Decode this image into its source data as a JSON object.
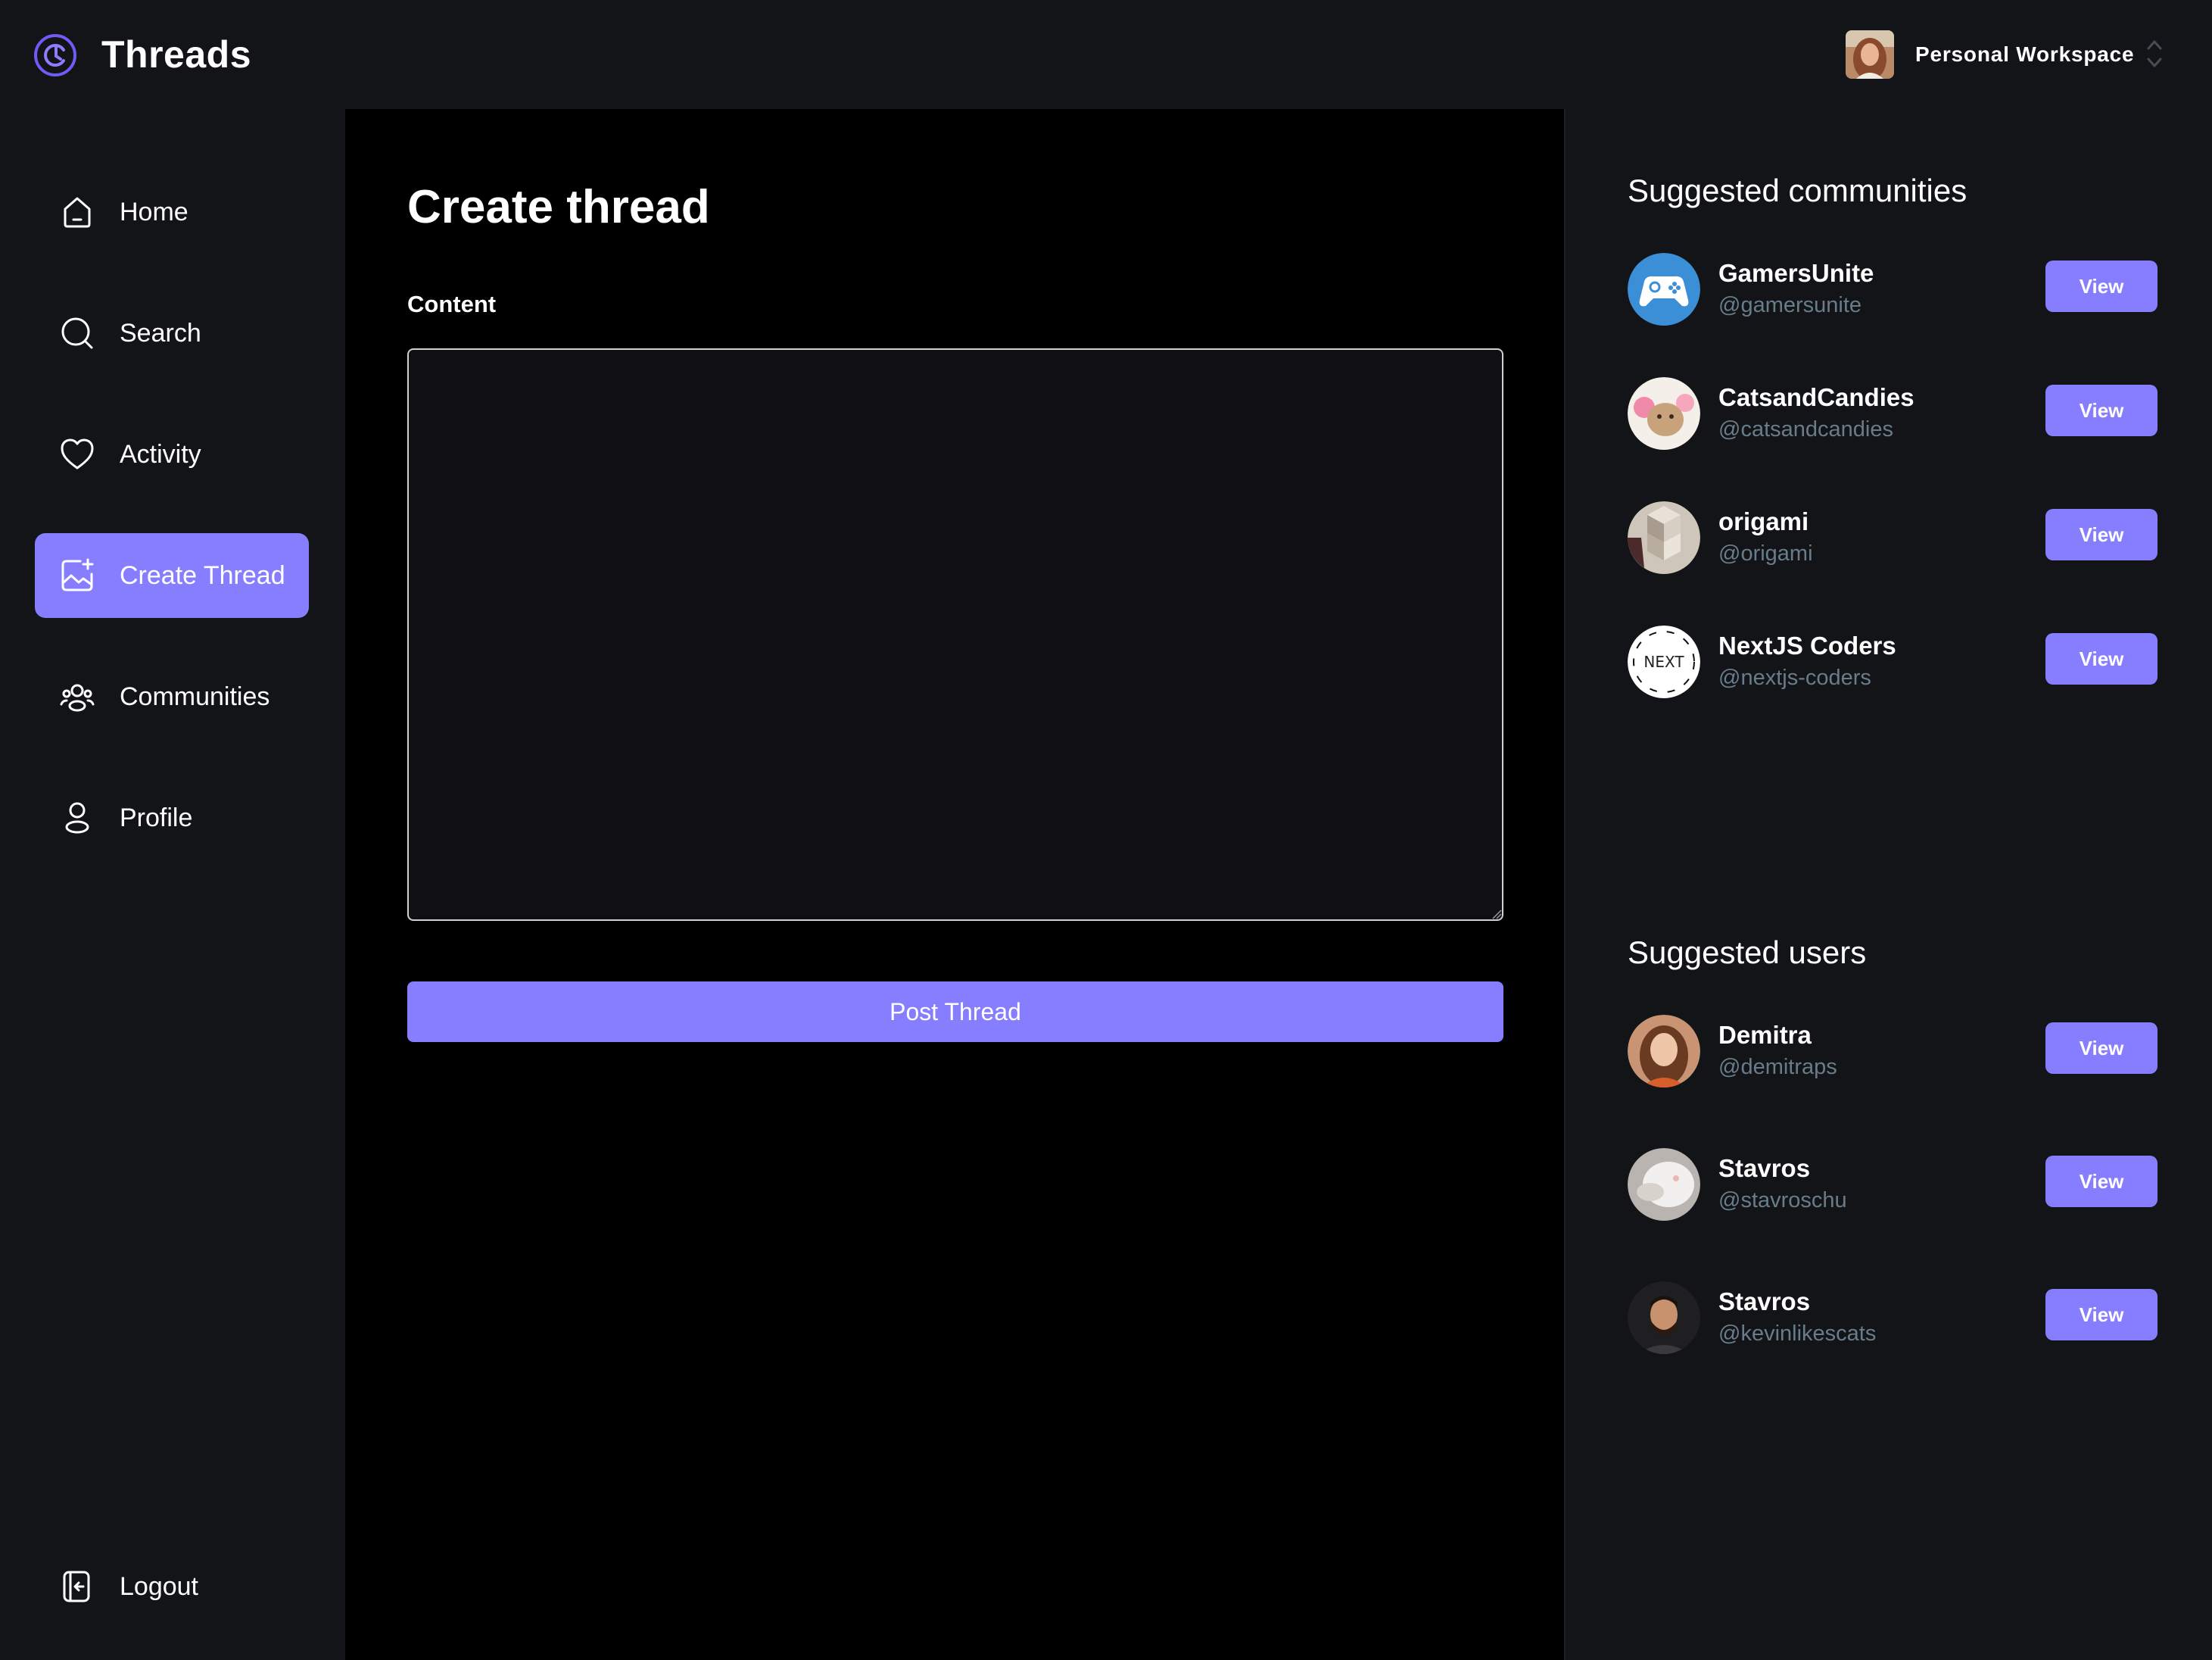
{
  "app": {
    "title": "Threads",
    "accent": "#877eff",
    "background": "#121417"
  },
  "workspace": {
    "name": "Personal Workspace",
    "avatar": "user-photo"
  },
  "sidebar": {
    "items": [
      {
        "label": "Home",
        "icon": "home-icon",
        "active": false
      },
      {
        "label": "Search",
        "icon": "search-icon",
        "active": false
      },
      {
        "label": "Activity",
        "icon": "heart-icon",
        "active": false
      },
      {
        "label": "Create Thread",
        "icon": "create-image-icon",
        "active": true
      },
      {
        "label": "Communities",
        "icon": "users-icon",
        "active": false
      },
      {
        "label": "Profile",
        "icon": "user-icon",
        "active": false
      }
    ],
    "logout": {
      "label": "Logout",
      "icon": "logout-icon"
    }
  },
  "main": {
    "title": "Create thread",
    "content_label": "Content",
    "content_value": "",
    "submit_label": "Post Thread"
  },
  "suggested_communities": {
    "title": "Suggested communities",
    "items": [
      {
        "name": "GamersUnite",
        "handle": "@gamersunite",
        "button": "View",
        "avatar": "gamepad-avatar"
      },
      {
        "name": "CatsandCandies",
        "handle": "@catsandcandies",
        "button": "View",
        "avatar": "cat-avatar"
      },
      {
        "name": "origami",
        "handle": "@origami",
        "button": "View",
        "avatar": "origami-avatar"
      },
      {
        "name": "NextJS Coders",
        "handle": "@nextjs-coders",
        "button": "View",
        "avatar": "nextjs-avatar",
        "avatar_text": "NEXT"
      }
    ]
  },
  "suggested_users": {
    "title": "Suggested users",
    "items": [
      {
        "name": "Demitra",
        "handle": "@demitraps",
        "button": "View",
        "avatar": "demitra-avatar"
      },
      {
        "name": "Stavros",
        "handle": "@stavroschu",
        "button": "View",
        "avatar": "stavros-avatar"
      },
      {
        "name": "Stavros",
        "handle": "@kevinlikescats",
        "button": "View",
        "avatar": "kevin-avatar"
      }
    ]
  }
}
